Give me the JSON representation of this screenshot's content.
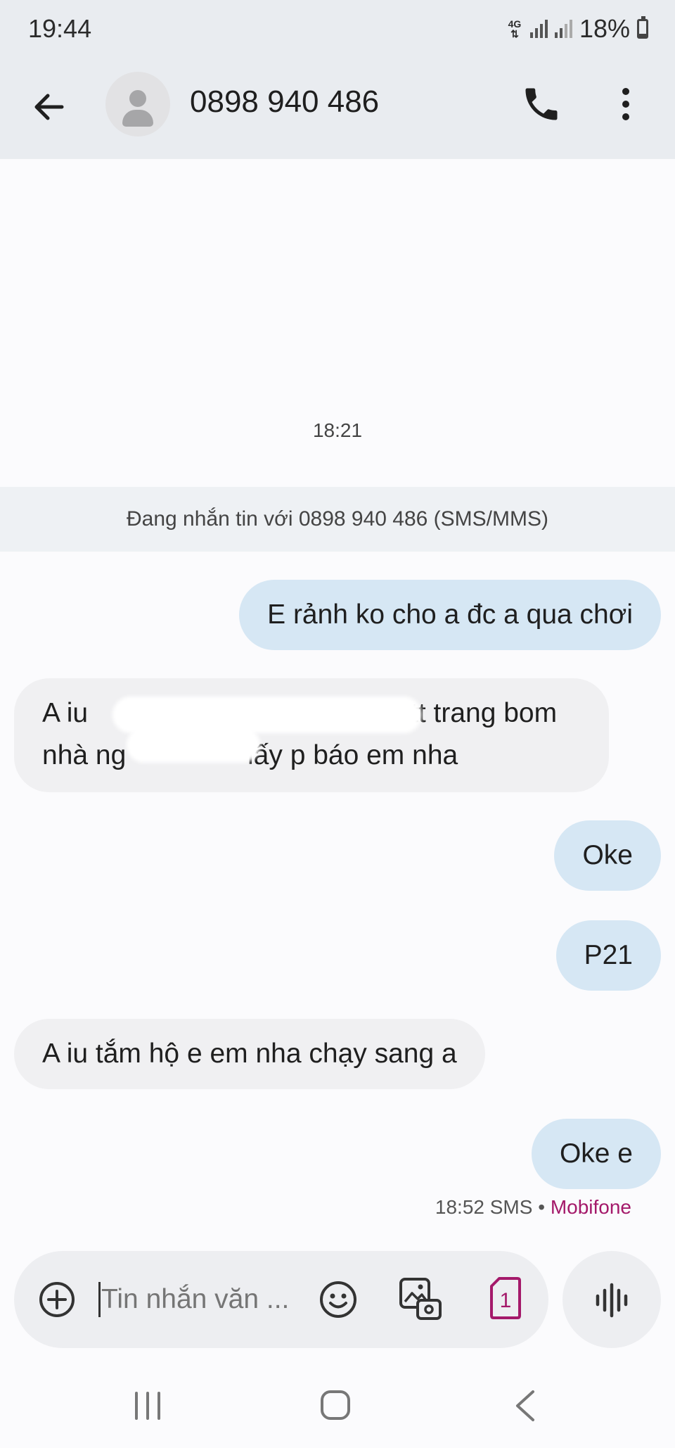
{
  "status_bar": {
    "time": "19:44",
    "network": "4G",
    "battery_text": "18%",
    "battery_level": 0.18
  },
  "header": {
    "contact": "0898 940 486"
  },
  "conversation": {
    "timestamp": "18:21",
    "info": "Đang nhắn tin với 0898 940 486 (SMS/MMS)",
    "messages": [
      {
        "direction": "outgoing",
        "text": "E rảnh ko cho a đc a qua chơi"
      },
      {
        "direction": "incoming",
        "line1": "A iu",
        "line1_end": "tt trang bom",
        "line2": "nhà ng",
        "line2_end": "lấy p báo em nha",
        "redacted": true
      },
      {
        "direction": "outgoing",
        "text": "Oke"
      },
      {
        "direction": "outgoing",
        "text": "P21"
      },
      {
        "direction": "incoming",
        "text": "A iu tắm hộ e em nha chạy sang a"
      },
      {
        "direction": "outgoing",
        "text": "Oke e"
      }
    ],
    "last_meta": {
      "time_type": "18:52 SMS",
      "separator": "•",
      "carrier": "Mobifone"
    }
  },
  "composer": {
    "placeholder": "Tin nhắn văn ...",
    "sim_number": "1"
  },
  "colors": {
    "outgoing_bubble": "#d6e7f4",
    "incoming_bubble": "#f0f0f2",
    "carrier_accent": "#a4196a"
  },
  "icons": [
    "back-arrow-icon",
    "contact-avatar-icon",
    "phone-icon",
    "more-vert-icon",
    "add-circle-icon",
    "emoji-icon",
    "gallery-icon",
    "sim-card-icon",
    "voice-wave-icon",
    "recents-icon",
    "home-icon",
    "nav-back-icon"
  ]
}
